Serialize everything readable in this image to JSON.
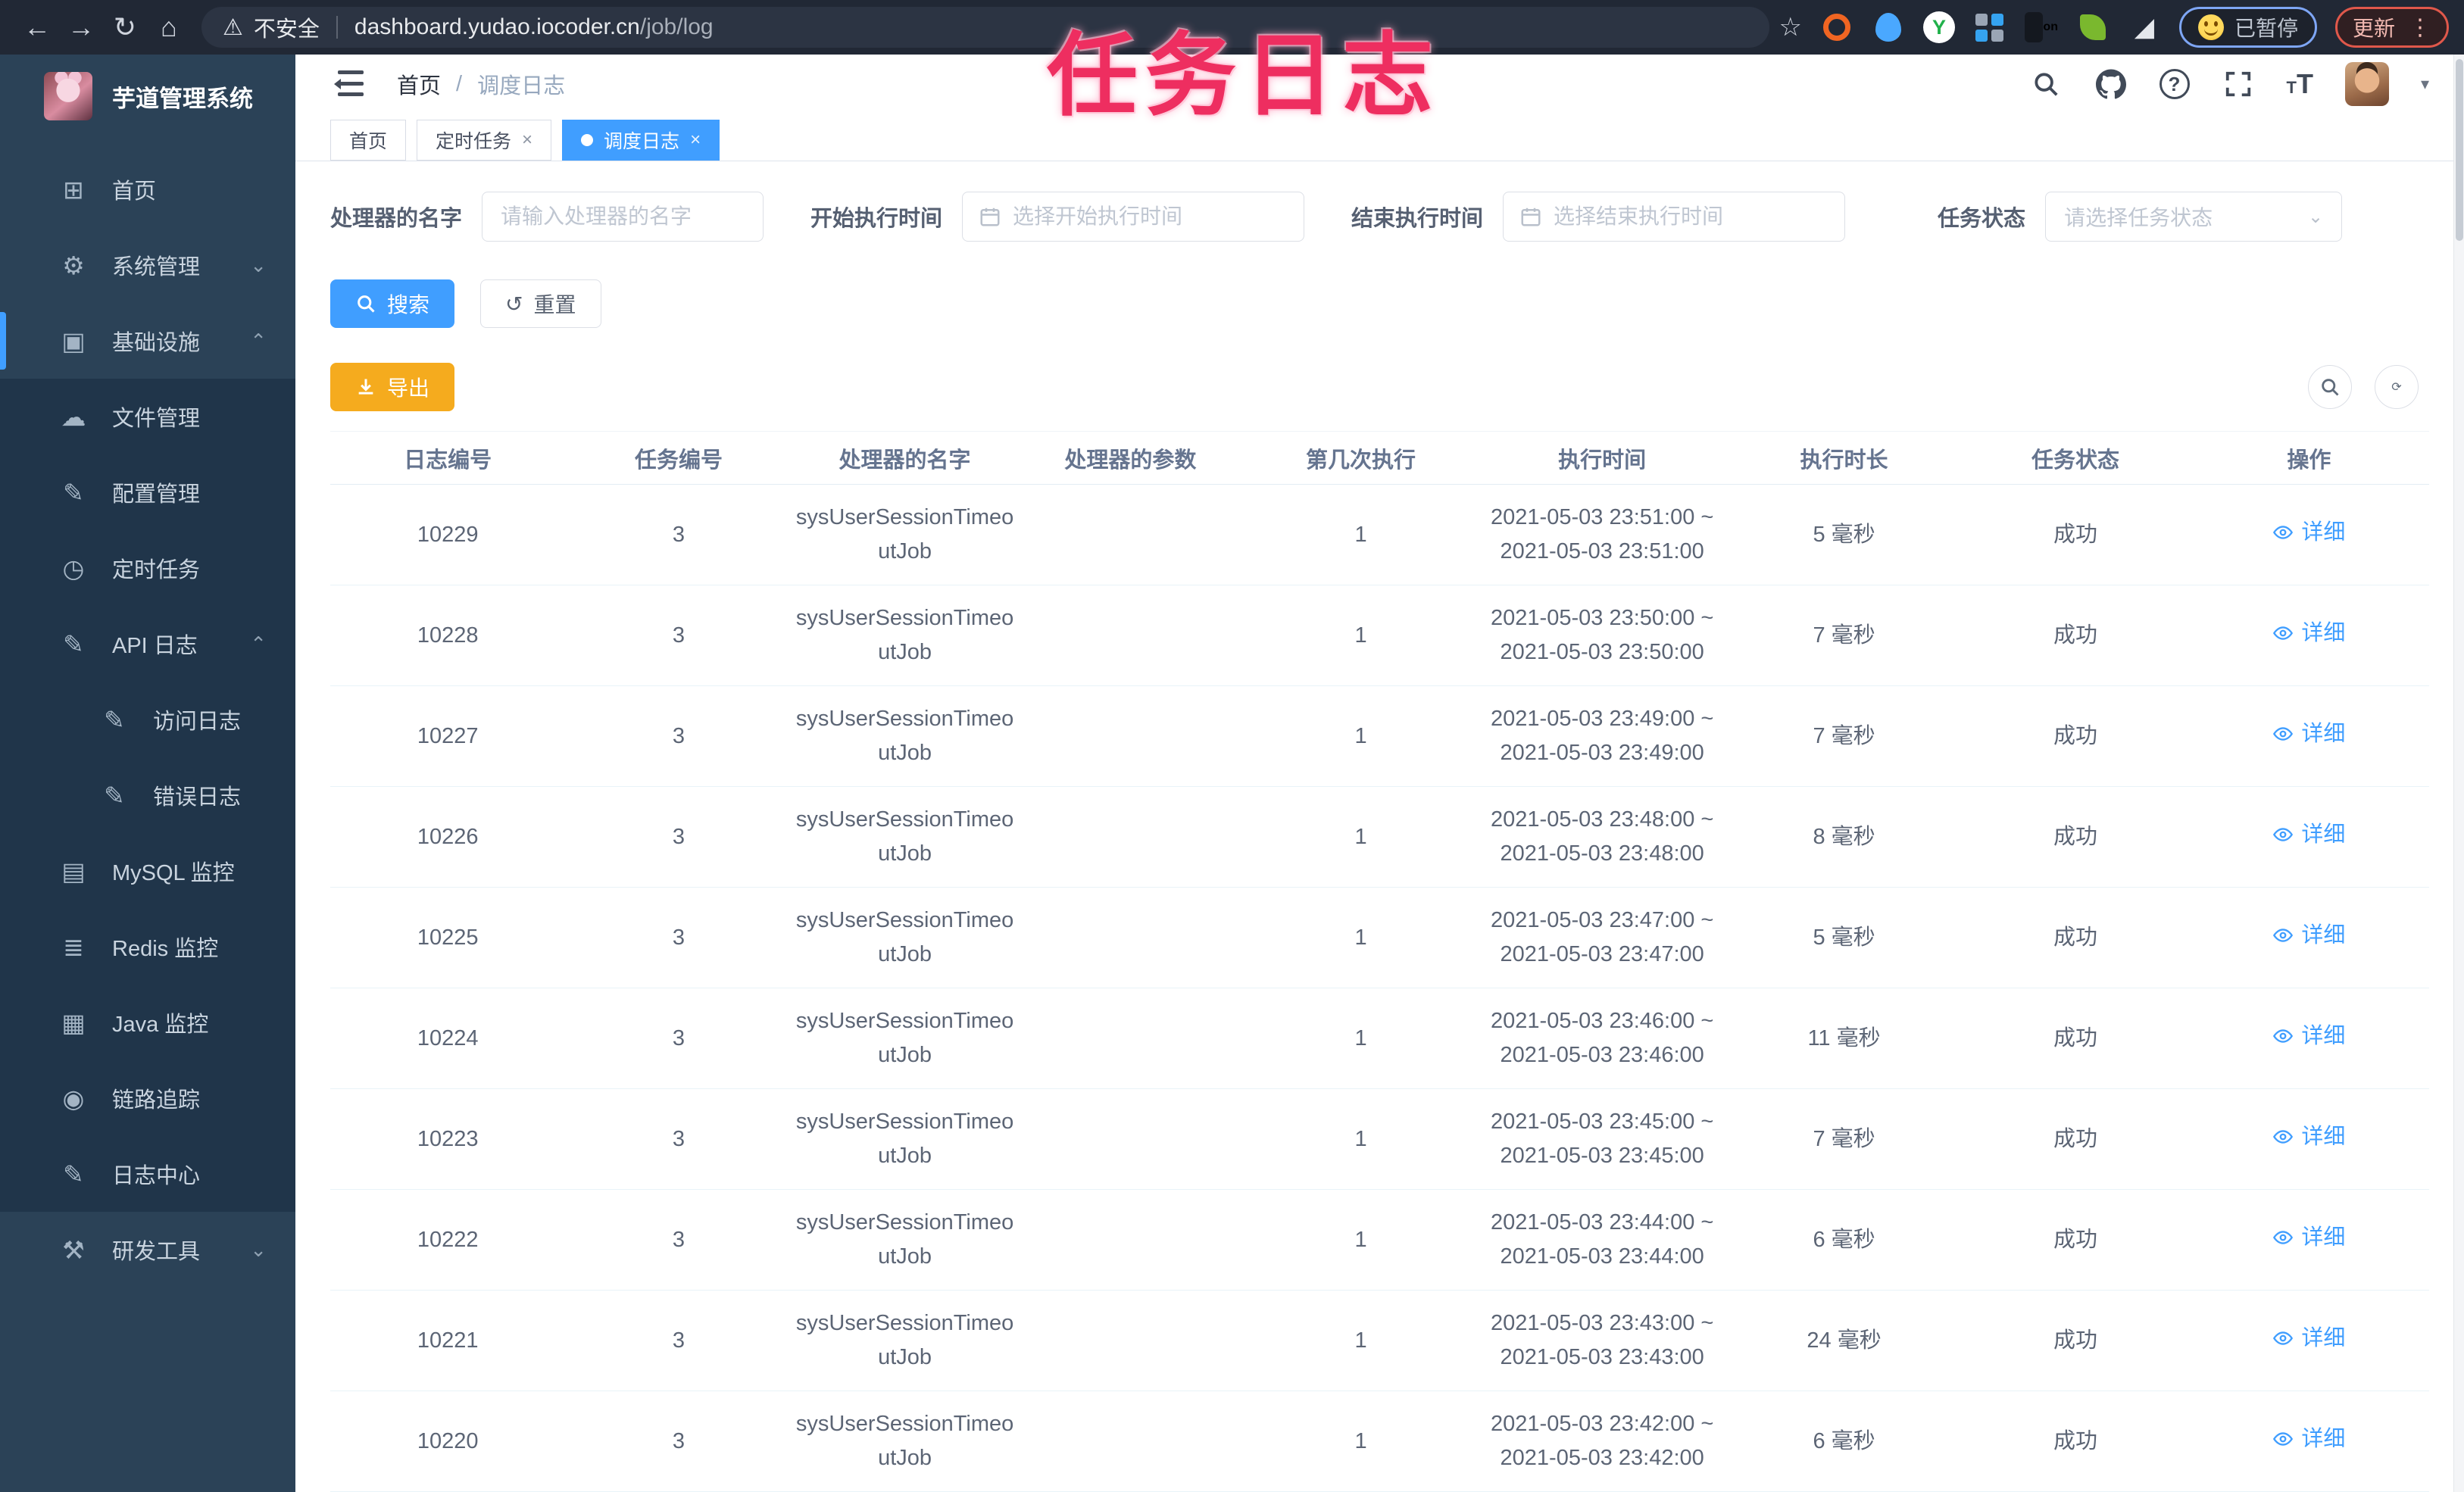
{
  "browser": {
    "security_label": "不安全",
    "url_host": "dashboard.yudao.iocoder.cn",
    "url_path": "/job/log",
    "paused_label": "已暂停",
    "update_label": "更新"
  },
  "overlay_title": "任务日志",
  "sidebar": {
    "app_title": "芋道管理系统",
    "items": [
      {
        "label": "首页",
        "icon": "dashboard-icon"
      },
      {
        "label": "系统管理",
        "icon": "gear-icon",
        "chevron": "down"
      },
      {
        "label": "基础设施",
        "icon": "monitor-icon",
        "chevron": "up",
        "active": true
      },
      {
        "label": "文件管理",
        "icon": "cloud-upload-icon"
      },
      {
        "label": "配置管理",
        "icon": "edit-icon"
      },
      {
        "label": "定时任务",
        "icon": "timer-icon"
      },
      {
        "label": "API 日志",
        "icon": "edit-icon",
        "chevron": "up"
      },
      {
        "label": "访问日志",
        "icon": "edit-icon"
      },
      {
        "label": "错误日志",
        "icon": "edit-icon"
      },
      {
        "label": "MySQL 监控",
        "icon": "chart-icon"
      },
      {
        "label": "Redis 监控",
        "icon": "layers-icon"
      },
      {
        "label": "Java 监控",
        "icon": "screen-icon"
      },
      {
        "label": "链路追踪",
        "icon": "eye-icon"
      },
      {
        "label": "日志中心",
        "icon": "log-icon"
      },
      {
        "label": "研发工具",
        "icon": "toolbox-icon",
        "chevron": "down"
      }
    ]
  },
  "header": {
    "breadcrumb_home": "首页",
    "breadcrumb_current": "调度日志"
  },
  "tabs": [
    {
      "label": "首页"
    },
    {
      "label": "定时任务"
    },
    {
      "label": "调度日志"
    }
  ],
  "filters": {
    "name_label": "处理器的名字",
    "name_placeholder": "请输入处理器的名字",
    "start_label": "开始执行时间",
    "start_placeholder": "选择开始执行时间",
    "end_label": "结束执行时间",
    "end_placeholder": "选择结束执行时间",
    "status_label": "任务状态",
    "status_placeholder": "请选择任务状态"
  },
  "actions": {
    "search": "搜索",
    "reset": "重置",
    "export": "导出"
  },
  "table": {
    "columns": [
      "日志编号",
      "任务编号",
      "处理器的名字",
      "处理器的参数",
      "第几次执行",
      "执行时间",
      "执行时长",
      "任务状态",
      "操作"
    ],
    "detail_label": "详细",
    "rows": [
      {
        "log_id": "10229",
        "job_id": "3",
        "handler": "sysUserSessionTimeoutJob",
        "param": "",
        "count": "1",
        "time_start": "2021-05-03 23:51:00 ~",
        "time_end": "2021-05-03 23:51:00",
        "duration": "5 毫秒",
        "status": "成功"
      },
      {
        "log_id": "10228",
        "job_id": "3",
        "handler": "sysUserSessionTimeoutJob",
        "param": "",
        "count": "1",
        "time_start": "2021-05-03 23:50:00 ~",
        "time_end": "2021-05-03 23:50:00",
        "duration": "7 毫秒",
        "status": "成功"
      },
      {
        "log_id": "10227",
        "job_id": "3",
        "handler": "sysUserSessionTimeoutJob",
        "param": "",
        "count": "1",
        "time_start": "2021-05-03 23:49:00 ~",
        "time_end": "2021-05-03 23:49:00",
        "duration": "7 毫秒",
        "status": "成功"
      },
      {
        "log_id": "10226",
        "job_id": "3",
        "handler": "sysUserSessionTimeoutJob",
        "param": "",
        "count": "1",
        "time_start": "2021-05-03 23:48:00 ~",
        "time_end": "2021-05-03 23:48:00",
        "duration": "8 毫秒",
        "status": "成功"
      },
      {
        "log_id": "10225",
        "job_id": "3",
        "handler": "sysUserSessionTimeoutJob",
        "param": "",
        "count": "1",
        "time_start": "2021-05-03 23:47:00 ~",
        "time_end": "2021-05-03 23:47:00",
        "duration": "5 毫秒",
        "status": "成功"
      },
      {
        "log_id": "10224",
        "job_id": "3",
        "handler": "sysUserSessionTimeoutJob",
        "param": "",
        "count": "1",
        "time_start": "2021-05-03 23:46:00 ~",
        "time_end": "2021-05-03 23:46:00",
        "duration": "11 毫秒",
        "status": "成功"
      },
      {
        "log_id": "10223",
        "job_id": "3",
        "handler": "sysUserSessionTimeoutJob",
        "param": "",
        "count": "1",
        "time_start": "2021-05-03 23:45:00 ~",
        "time_end": "2021-05-03 23:45:00",
        "duration": "7 毫秒",
        "status": "成功"
      },
      {
        "log_id": "10222",
        "job_id": "3",
        "handler": "sysUserSessionTimeoutJob",
        "param": "",
        "count": "1",
        "time_start": "2021-05-03 23:44:00 ~",
        "time_end": "2021-05-03 23:44:00",
        "duration": "6 毫秒",
        "status": "成功"
      },
      {
        "log_id": "10221",
        "job_id": "3",
        "handler": "sysUserSessionTimeoutJob",
        "param": "",
        "count": "1",
        "time_start": "2021-05-03 23:43:00 ~",
        "time_end": "2021-05-03 23:43:00",
        "duration": "24 毫秒",
        "status": "成功"
      },
      {
        "log_id": "10220",
        "job_id": "3",
        "handler": "sysUserSessionTimeoutJob",
        "param": "",
        "count": "1",
        "time_start": "2021-05-03 23:42:00 ~",
        "time_end": "2021-05-03 23:42:00",
        "duration": "6 毫秒",
        "status": "成功"
      }
    ]
  }
}
